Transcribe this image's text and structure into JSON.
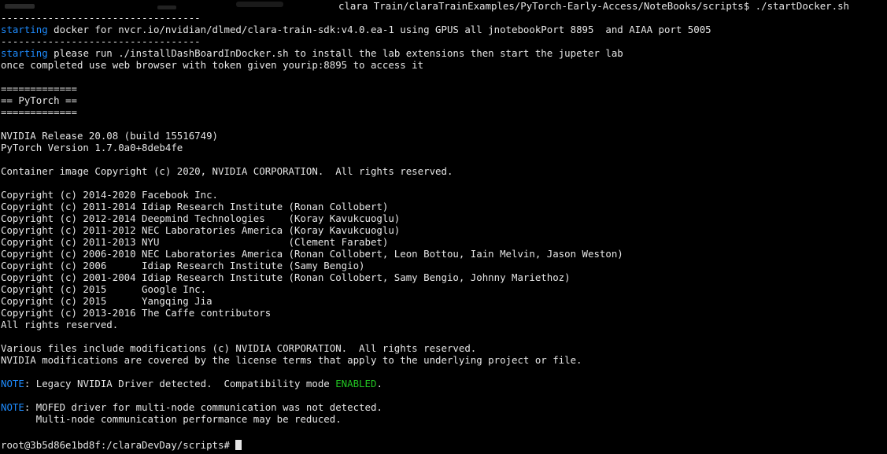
{
  "window": {
    "command_path": "clara Train/claraTrainExamples/PyTorch-Early-Access/NoteBooks/scripts$ ./startDocker.sh"
  },
  "lines": {
    "l1": "----------------------------------",
    "l2_kw": "starting",
    "l2_rest": " docker for nvcr.io/nvidian/dlmed/clara-train-sdk:v4.0.ea-1 using GPUS all jnotebookPort 8895  and AIAA port 5005",
    "l3": "----------------------------------",
    "l4_kw": "starting",
    "l4_rest": " please run ./installDashBoardInDocker.sh to install the lab extensions then start the jupeter lab",
    "l5": "once completed use web browser with token given yourip:8895 to access it",
    "l7": "=============",
    "l8": "== PyTorch ==",
    "l9": "=============",
    "l11": "NVIDIA Release 20.08 (build 15516749)",
    "l12": "PyTorch Version 1.7.0a0+8deb4fe",
    "l14": "Container image Copyright (c) 2020, NVIDIA CORPORATION.  All rights reserved.",
    "l16": "Copyright (c) 2014-2020 Facebook Inc.",
    "l17": "Copyright (c) 2011-2014 Idiap Research Institute (Ronan Collobert)",
    "l18": "Copyright (c) 2012-2014 Deepmind Technologies    (Koray Kavukcuoglu)",
    "l19": "Copyright (c) 2011-2012 NEC Laboratories America (Koray Kavukcuoglu)",
    "l20": "Copyright (c) 2011-2013 NYU                      (Clement Farabet)",
    "l21": "Copyright (c) 2006-2010 NEC Laboratories America (Ronan Collobert, Leon Bottou, Iain Melvin, Jason Weston)",
    "l22": "Copyright (c) 2006      Idiap Research Institute (Samy Bengio)",
    "l23": "Copyright (c) 2001-2004 Idiap Research Institute (Ronan Collobert, Samy Bengio, Johnny Mariethoz)",
    "l24": "Copyright (c) 2015      Google Inc.",
    "l25": "Copyright (c) 2015      Yangqing Jia",
    "l26": "Copyright (c) 2013-2016 The Caffe contributors",
    "l27": "All rights reserved.",
    "l29": "Various files include modifications (c) NVIDIA CORPORATION.  All rights reserved.",
    "l30": "NVIDIA modifications are covered by the license terms that apply to the underlying project or file.",
    "l32_note": "NOTE",
    "l32_mid": ": Legacy NVIDIA Driver detected.  Compatibility mode ",
    "l32_enabled": "ENABLED",
    "l32_end": ".",
    "l34_note": "NOTE",
    "l34_rest": ": MOFED driver for multi-node communication was not detected.",
    "l35": "      Multi-node communication performance may be reduced."
  },
  "prompt": {
    "text": "root@3b5d86e1bd8f:/claraDevDay/scripts# "
  },
  "colors": {
    "background": "#000000",
    "text": "#e6e6e6",
    "keyword_blue": "#1e8cff",
    "enabled_green": "#22c422"
  }
}
